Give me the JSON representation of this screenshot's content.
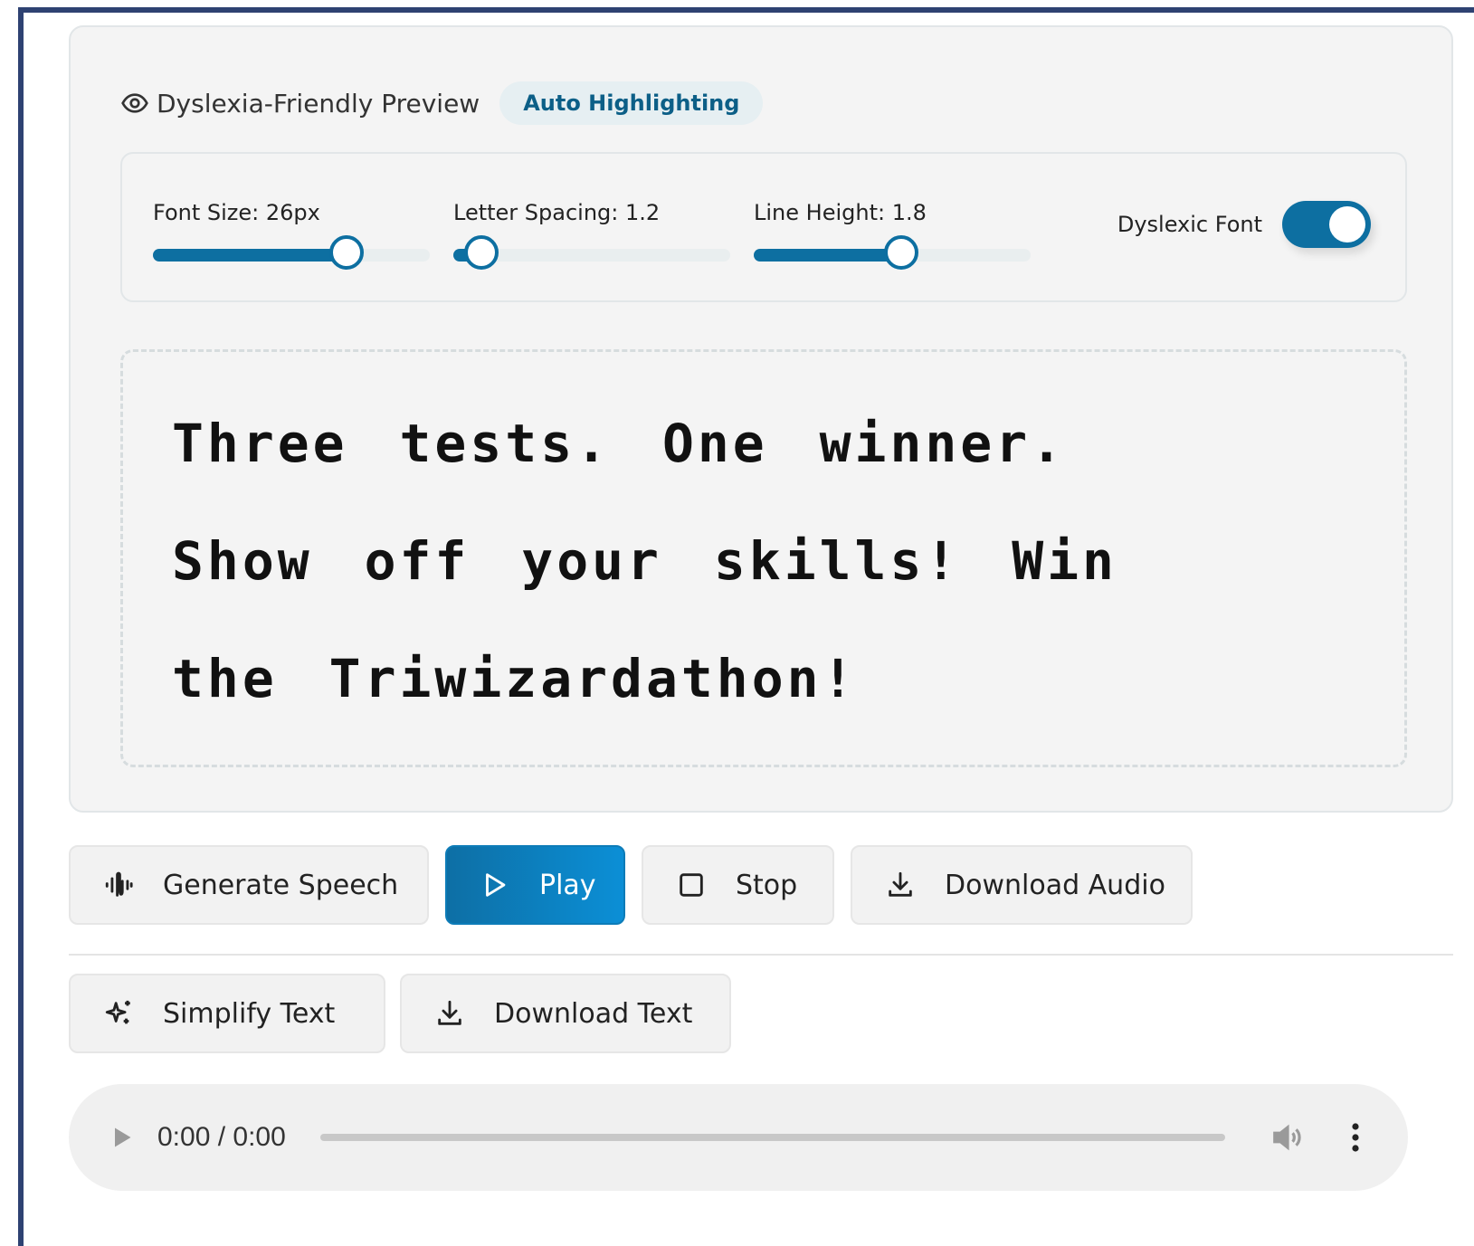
{
  "preview": {
    "title": "Dyslexia-Friendly Preview",
    "badge": "Auto Highlighting",
    "text": "Three tests. One winner. Show off your skills! Win the Triwizardathon!"
  },
  "controls": {
    "font_size": {
      "label": "Font Size: 26px",
      "value": 26,
      "min": 12,
      "max": 32
    },
    "letter_spacing": {
      "label": "Letter Spacing: 1.2",
      "value": 1.2,
      "min": 1.0,
      "max": 3.0
    },
    "line_height": {
      "label": "Line Height: 1.8",
      "value": 1.8,
      "min": 1.0,
      "max": 2.5
    },
    "dyslexic_font": {
      "label": "Dyslexic Font",
      "enabled": true
    }
  },
  "buttons": {
    "generate_speech": "Generate Speech",
    "play": "Play",
    "stop": "Stop",
    "download_audio": "Download Audio",
    "simplify_text": "Simplify Text",
    "download_text": "Download Text"
  },
  "audio": {
    "time": "0:00 / 0:00",
    "progress": 0
  },
  "colors": {
    "accent": "#0d6fa1",
    "frame_border": "#2e4272",
    "badge_text": "#0c5f87"
  }
}
